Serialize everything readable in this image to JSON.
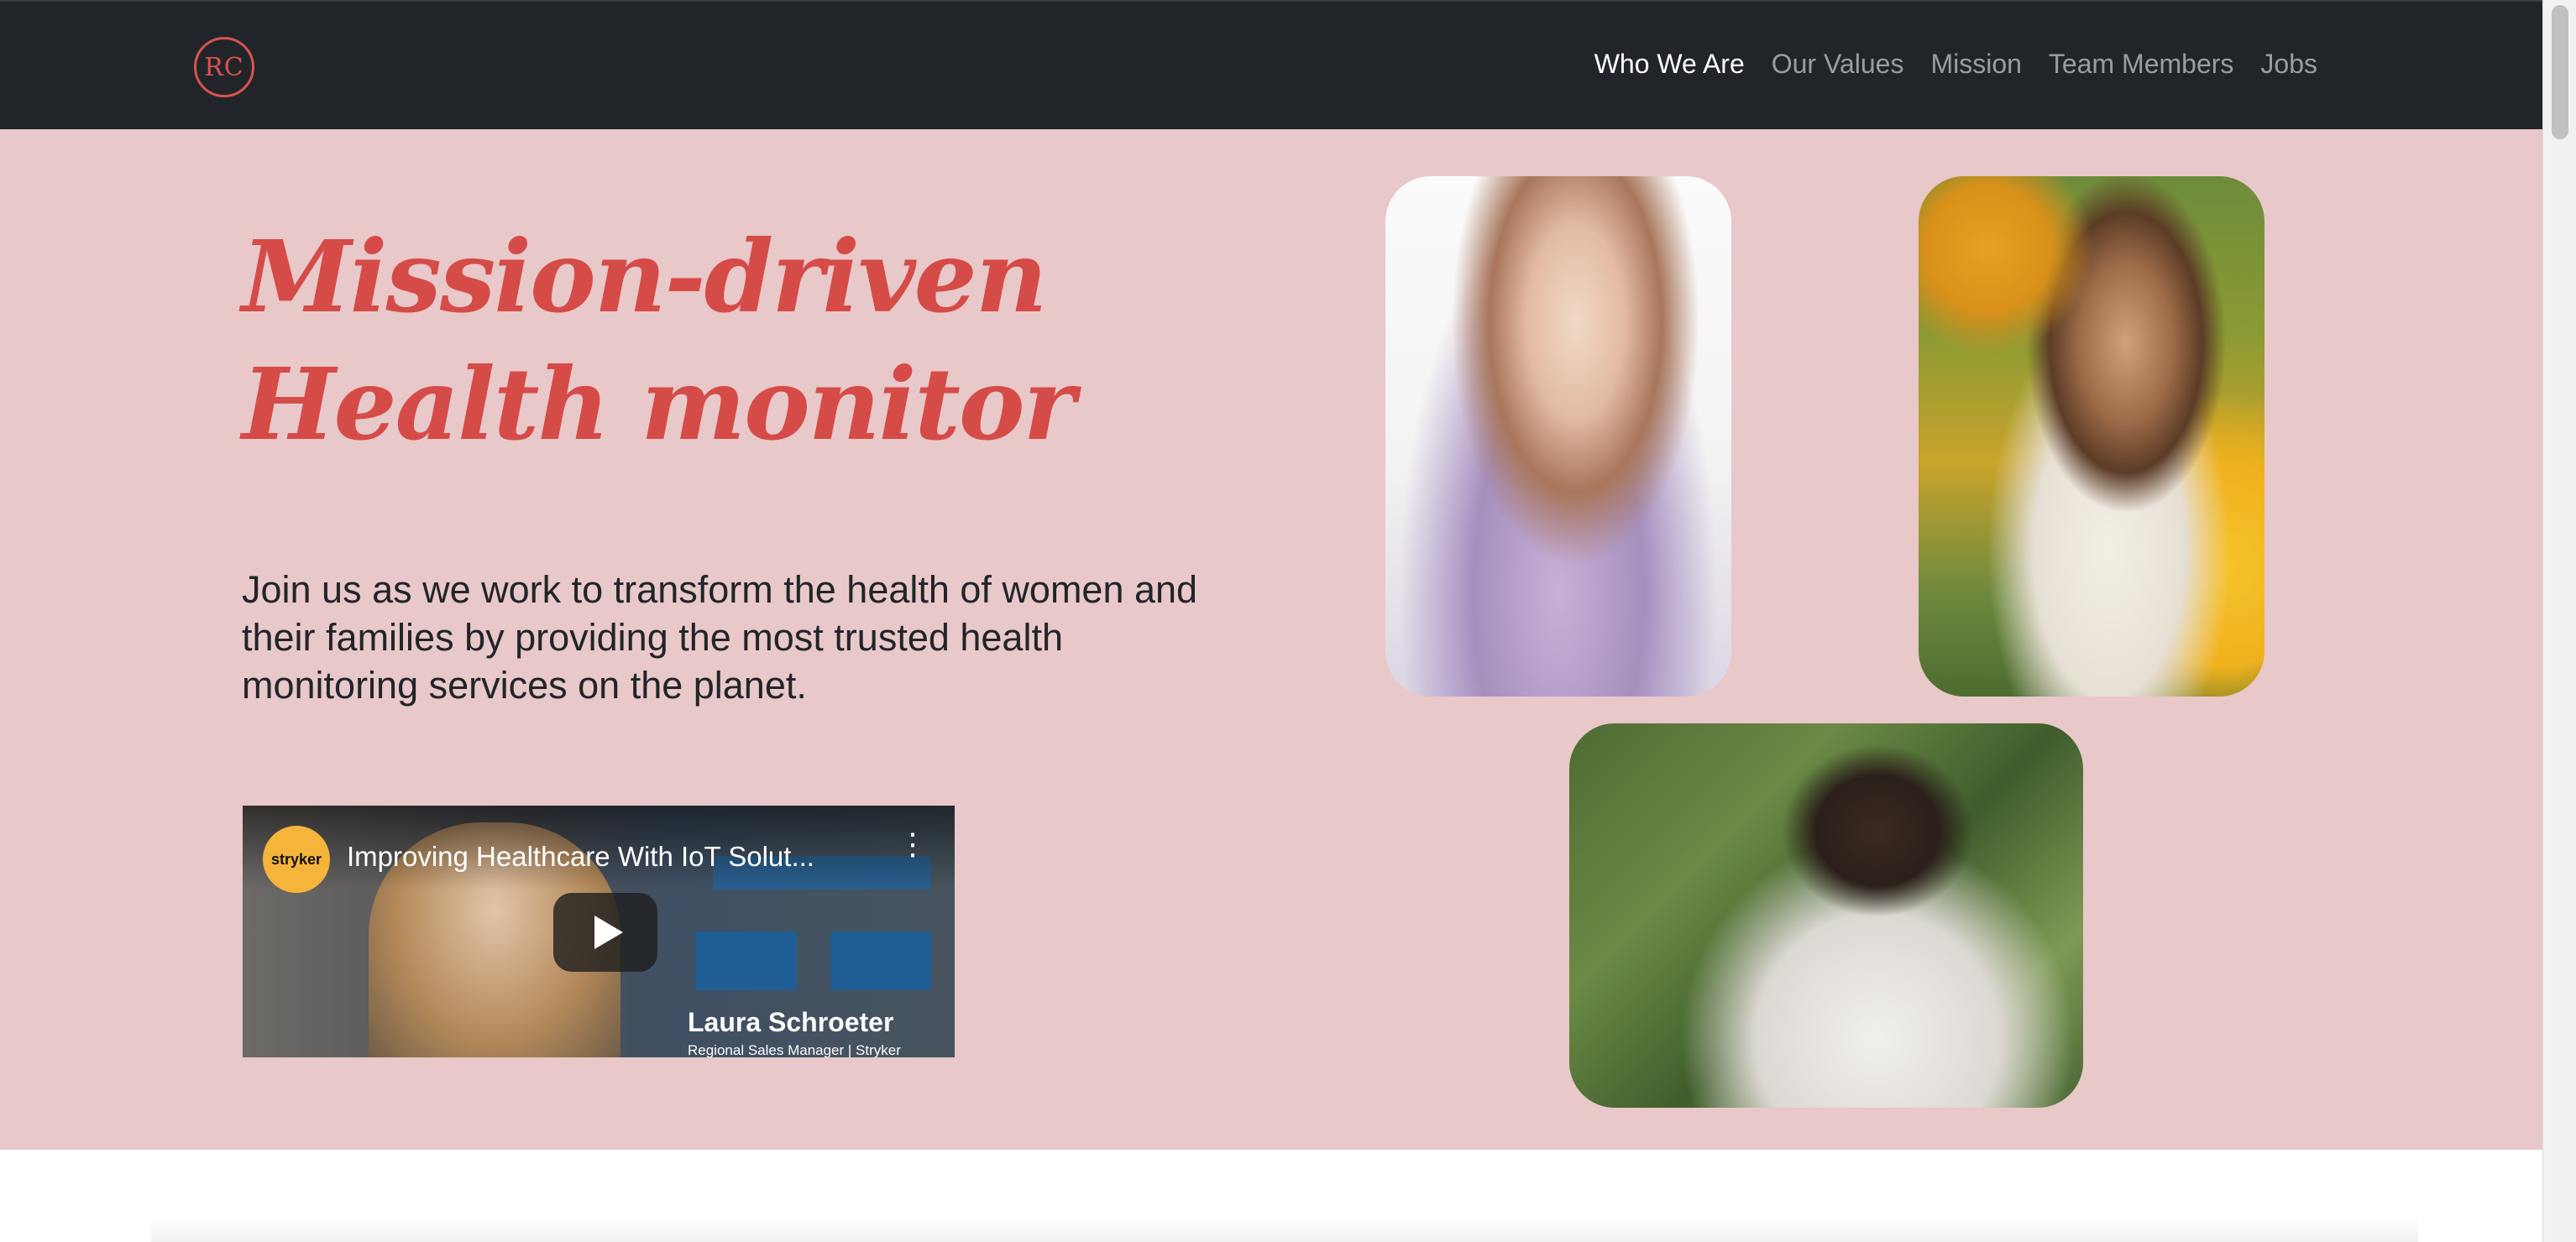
{
  "brand": {
    "logo_text": "RC",
    "accent_color": "#d54b48"
  },
  "nav": {
    "items": [
      {
        "label": "Who We Are",
        "active": true
      },
      {
        "label": "Our Values",
        "active": false
      },
      {
        "label": "Mission",
        "active": false
      },
      {
        "label": "Team Members",
        "active": false
      },
      {
        "label": "Jobs",
        "active": false
      }
    ],
    "background": "#212529"
  },
  "hero": {
    "background": "#e8c8c9",
    "headline_line1": "Mission-driven",
    "headline_line2": "Health monitor",
    "lead": "Join us as we work to transform the health of women and their families by providing the most trusted health monitoring services on the planet."
  },
  "video": {
    "channel_logo_text": "stryker",
    "title": "Improving Healthcare With IoT Solut...",
    "lower_third_name": "Laura Schroeter",
    "lower_third_role": "Regional Sales Manager | Stryker",
    "menu_icon": "kebab-menu-icon",
    "play_icon": "play-icon"
  }
}
